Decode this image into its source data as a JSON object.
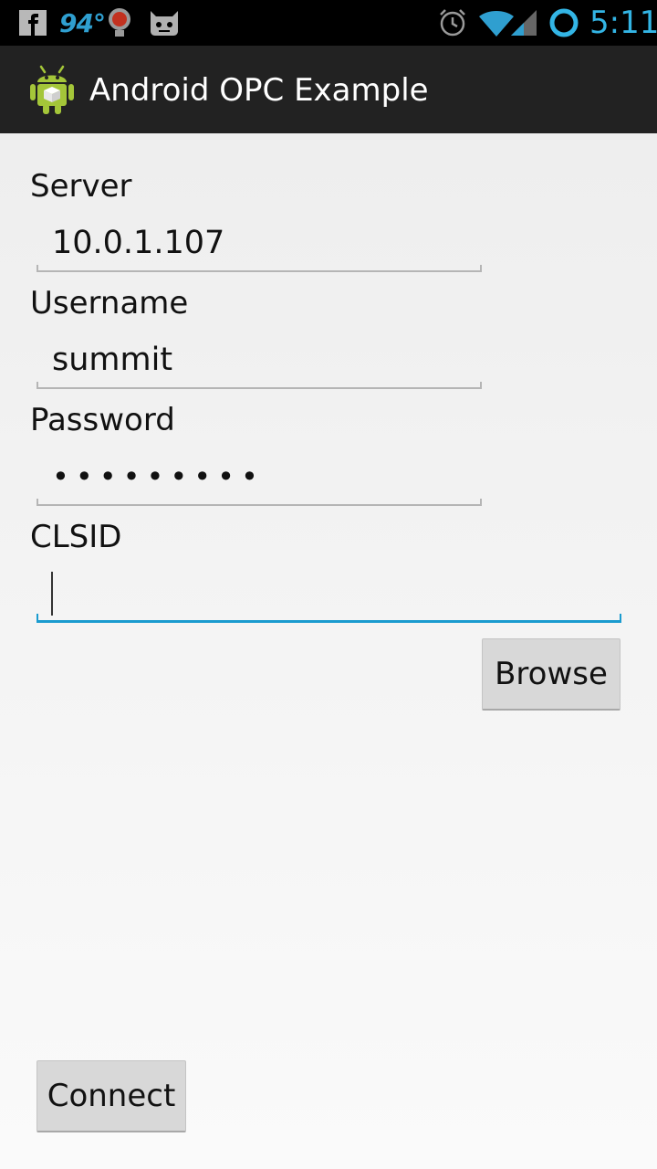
{
  "status_bar": {
    "temperature": "94°",
    "time": "5:11",
    "icons": [
      "facebook-icon",
      "weather-bulb-icon",
      "cyanogen-mascot-icon",
      "alarm-icon",
      "wifi-icon",
      "cell-signal-icon",
      "sync-ring-icon"
    ]
  },
  "action_bar": {
    "title": "Android OPC Example",
    "app_icon": "android-robot-icon"
  },
  "form": {
    "server_label": "Server",
    "server_value": "10.0.1.107",
    "username_label": "Username",
    "username_value": "summit",
    "password_label": "Password",
    "password_value": "•••••••••",
    "clsid_label": "CLSID",
    "clsid_value": "",
    "browse_label": "Browse",
    "connect_label": "Connect"
  },
  "colors": {
    "accent": "#33b5e5",
    "actionbar": "#222222",
    "statusbar": "#000000"
  }
}
